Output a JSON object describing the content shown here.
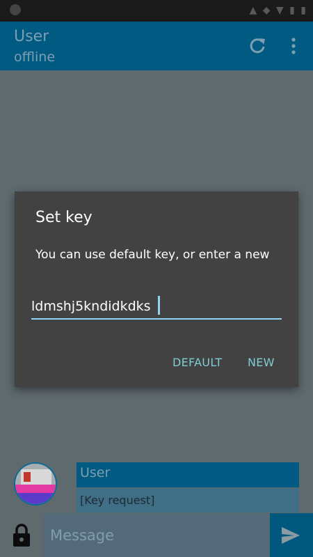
{
  "appbar": {
    "title": "User",
    "subtitle": "offline",
    "refresh_icon": "refresh-icon",
    "more_icon": "more-vert-icon"
  },
  "dialog": {
    "title": "Set key",
    "message": "You can use default key, or enter a new",
    "key_value": "ldmshj5kndidkdks",
    "default_label": "DEFAULT",
    "new_label": "NEW"
  },
  "chat": {
    "sender_name": "User",
    "message_text": "[Key request]"
  },
  "composer": {
    "placeholder": "Message",
    "lock_icon": "lock-icon",
    "send_icon": "send-icon"
  },
  "colors": {
    "primary": "#005a82",
    "accent": "#8fd3f5",
    "dialog_bg": "#424242",
    "dialog_button": "#7fcdd2"
  }
}
